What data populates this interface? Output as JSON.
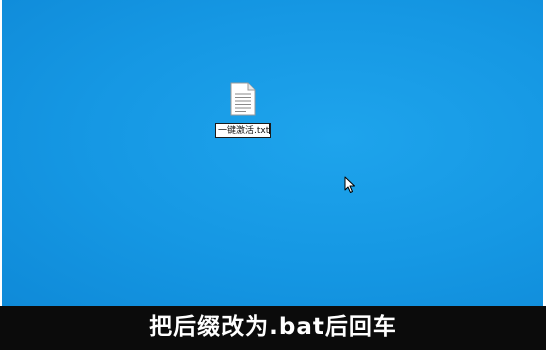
{
  "desktop": {
    "background_color": "#1597e3",
    "file": {
      "icon": "text-file-icon",
      "rename_value": "一键激活.txt"
    },
    "cursor_icon": "mouse-pointer-icon"
  },
  "caption": {
    "text": "把后缀改为.bat后回车",
    "background_color": "#0b0b0b",
    "text_color": "#ffffff"
  }
}
